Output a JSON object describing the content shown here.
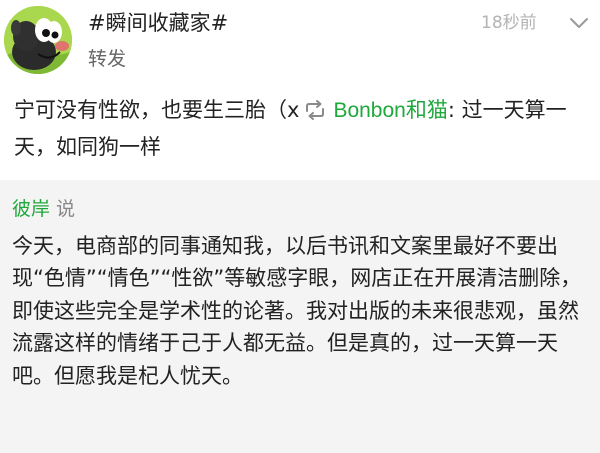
{
  "post": {
    "author": "#瞬间收藏家#",
    "type": "转发",
    "time": "18秒前",
    "avatar_icon": "cartoon-mole-avatar",
    "more_icon": "chevron-down-icon",
    "repost_text": "宁可没有性欲，也要生三胎（x",
    "repost_icon": "repost-icon",
    "original_user": "Bonbon和猫",
    "original_text": ": 过一天算一天，如同狗一样"
  },
  "quote": {
    "author": "彼岸",
    "said": "说",
    "body": "今天，电商部的同事通知我，以后书讯和文案里最好不要出现“色情”“情色”“性欲”等敏感字眼，网店正在开展清洁删除，即使这些完全是学术性的论著。我对出版的未来很悲观，虽然流露这样的情绪于己于人都无益。但是真的，过一天算一天吧。但愿我是杞人忧天。"
  },
  "colors": {
    "link_green": "#1fa83c",
    "time_gray": "#b3b3b3",
    "card_background": "#f4f4f4",
    "text": "#222222"
  }
}
